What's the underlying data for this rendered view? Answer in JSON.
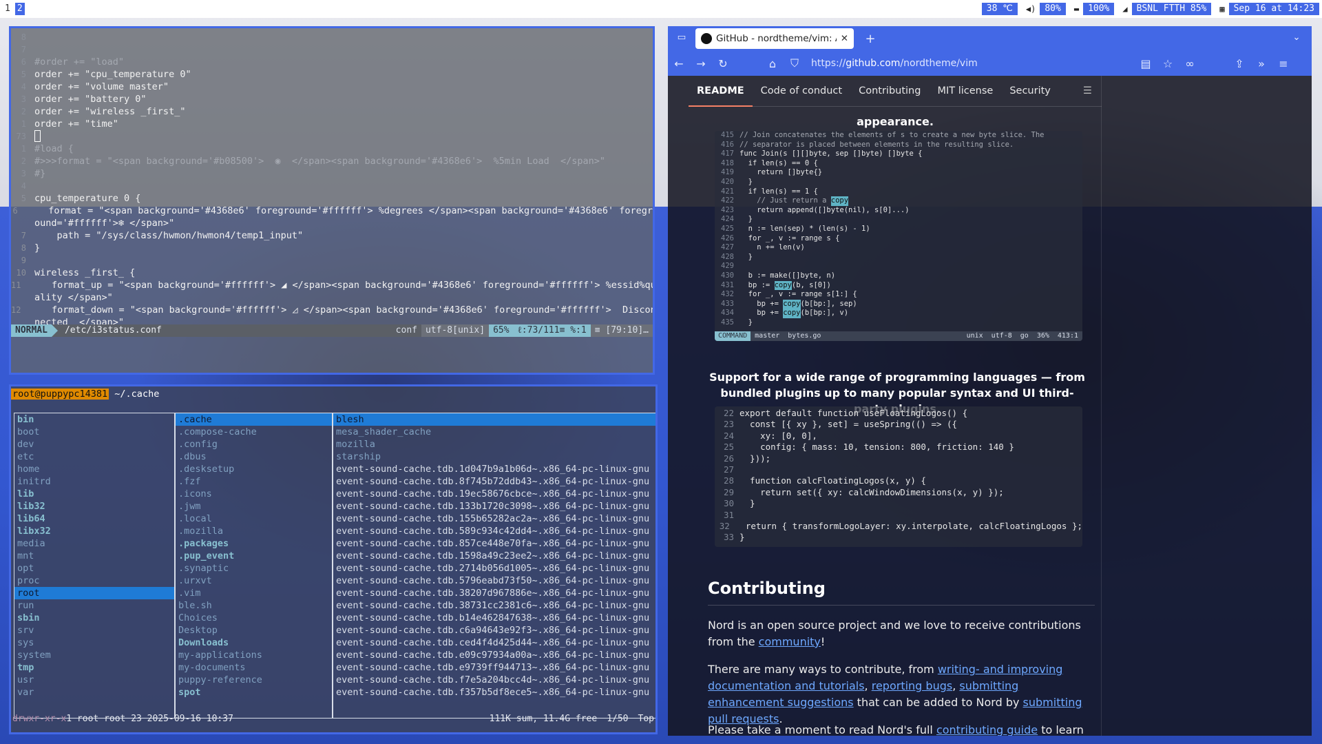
{
  "bar": {
    "workspaces": [
      "1",
      "2"
    ],
    "temperature": "38 ℃",
    "volume": "80%",
    "battery": "100%",
    "wireless": "BSNL FTTH 85%",
    "time": "Sep 16 at 14:23"
  },
  "vim": {
    "lines": [
      {
        "n": "8",
        "t": ""
      },
      {
        "n": "7",
        "t": ""
      },
      {
        "n": "6",
        "t": "#order += \"load\"",
        "c": "cmt"
      },
      {
        "n": "5",
        "t": "order += \"cpu_temperature 0\""
      },
      {
        "n": "4",
        "t": "order += \"volume master\""
      },
      {
        "n": "3",
        "t": "order += \"battery 0\""
      },
      {
        "n": "2",
        "t": "order += \"wireless _first_\""
      },
      {
        "n": "1",
        "t": "order += \"time\""
      },
      {
        "n": "73",
        "t": "",
        "cursor": true
      },
      {
        "n": "1",
        "t": "#load {",
        "c": "cmt"
      },
      {
        "n": "2",
        "t": "#>>>format = \"<span background='#b08500'>  ◉  </span><span background='#4368e6'>  %5min Load  </span>\"",
        "c": "cmt"
      },
      {
        "n": "3",
        "t": "#}",
        "c": "cmt"
      },
      {
        "n": "4",
        "t": ""
      },
      {
        "n": "5",
        "t": "cpu_temperature 0 {"
      },
      {
        "n": "6",
        "t": "    format = \"<span background='#4368e6' foreground='#ffffff'> %degrees </span><span background='#4368e6' foregr"
      },
      {
        "n": "",
        "t": "ound='#ffffff'>❄ </span>\""
      },
      {
        "n": "7",
        "t": "    path = \"/sys/class/hwmon/hwmon4/temp1_input\""
      },
      {
        "n": "8",
        "t": "}"
      },
      {
        "n": "9",
        "t": ""
      },
      {
        "n": "10",
        "t": "wireless _first_ {"
      },
      {
        "n": "11",
        "t": "    format_up = \"<span background='#ffffff'> ◢ </span><span background='#4368e6' foreground='#ffffff'> %essid%qu"
      },
      {
        "n": "",
        "t": "ality </span>\""
      },
      {
        "n": "12",
        "t": "    format_down = \"<span background='#ffffff'> ◿ </span><span background='#4368e6' foreground='#ffffff'>  Discon"
      },
      {
        "n": "",
        "t": "nected  </span>\""
      }
    ],
    "status": {
      "mode": "NORMAL",
      "file": "/etc/i3status.conf",
      "filetype": "conf",
      "encoding": "utf-8[unix]",
      "percent": "65%",
      "position": "ℓ:73/111≡ %:1",
      "extra": "≡ [79:10]…"
    }
  },
  "ranger": {
    "user": "root@puppypc14381",
    "path": " ~/.cache",
    "col1": [
      {
        "t": "bin",
        "k": "dir"
      },
      {
        "t": "boot",
        "k": "hid"
      },
      {
        "t": "dev",
        "k": "hid"
      },
      {
        "t": "etc",
        "k": "hid"
      },
      {
        "t": "home",
        "k": "hid"
      },
      {
        "t": "initrd",
        "k": "hid"
      },
      {
        "t": "lib",
        "k": "dir"
      },
      {
        "t": "lib32",
        "k": "dir"
      },
      {
        "t": "lib64",
        "k": "dir"
      },
      {
        "t": "libx32",
        "k": "dir"
      },
      {
        "t": "media",
        "k": "hid"
      },
      {
        "t": "mnt",
        "k": "hid"
      },
      {
        "t": "opt",
        "k": "hid"
      },
      {
        "t": "proc",
        "k": "hid"
      },
      {
        "t": "root",
        "k": "sel"
      },
      {
        "t": "run",
        "k": "hid"
      },
      {
        "t": "sbin",
        "k": "dir"
      },
      {
        "t": "srv",
        "k": "hid"
      },
      {
        "t": "sys",
        "k": "hid"
      },
      {
        "t": "system",
        "k": "hid"
      },
      {
        "t": "tmp",
        "k": "dir"
      },
      {
        "t": "usr",
        "k": "hid"
      },
      {
        "t": "var",
        "k": "hid"
      }
    ],
    "col2": [
      {
        "t": ".cache",
        "k": "sel"
      },
      {
        "t": ".compose-cache",
        "k": "hid"
      },
      {
        "t": ".config",
        "k": "hid"
      },
      {
        "t": ".dbus",
        "k": "hid"
      },
      {
        "t": ".desksetup",
        "k": "hid"
      },
      {
        "t": ".fzf",
        "k": "hid"
      },
      {
        "t": ".icons",
        "k": "hid"
      },
      {
        "t": ".jwm",
        "k": "hid"
      },
      {
        "t": ".local",
        "k": "hid"
      },
      {
        "t": ".mozilla",
        "k": "hid"
      },
      {
        "t": ".packages",
        "k": "dir"
      },
      {
        "t": ".pup_event",
        "k": "dir"
      },
      {
        "t": ".synaptic",
        "k": "hid"
      },
      {
        "t": ".urxvt",
        "k": "hid"
      },
      {
        "t": ".vim",
        "k": "hid"
      },
      {
        "t": "ble.sh",
        "k": "hid"
      },
      {
        "t": "Choices",
        "k": "hid"
      },
      {
        "t": "Desktop",
        "k": "hid"
      },
      {
        "t": "Downloads",
        "k": "dir"
      },
      {
        "t": "my-applications",
        "k": "hid"
      },
      {
        "t": "my-documents",
        "k": "hid"
      },
      {
        "t": "puppy-reference",
        "k": "hid"
      },
      {
        "t": "spot",
        "k": "dir"
      }
    ],
    "col3": [
      {
        "t": "blesh",
        "k": "sel"
      },
      {
        "t": "mesa_shader_cache",
        "k": "hid"
      },
      {
        "t": "mozilla",
        "k": "hid"
      },
      {
        "t": "starship",
        "k": "hid"
      },
      {
        "t": "event-sound-cache.tdb.1d047b9a1b06d~.x86_64-pc-linux-gnu",
        "k": "file"
      },
      {
        "t": "event-sound-cache.tdb.8f745b72ddb43~.x86_64-pc-linux-gnu",
        "k": "file"
      },
      {
        "t": "event-sound-cache.tdb.19ec58676cbce~.x86_64-pc-linux-gnu",
        "k": "file"
      },
      {
        "t": "event-sound-cache.tdb.133b1720c3098~.x86_64-pc-linux-gnu",
        "k": "file"
      },
      {
        "t": "event-sound-cache.tdb.155b65282ac2a~.x86_64-pc-linux-gnu",
        "k": "file"
      },
      {
        "t": "event-sound-cache.tdb.589c934c42dd4~.x86_64-pc-linux-gnu",
        "k": "file"
      },
      {
        "t": "event-sound-cache.tdb.857ce448e70fa~.x86_64-pc-linux-gnu",
        "k": "file"
      },
      {
        "t": "event-sound-cache.tdb.1598a49c23ee2~.x86_64-pc-linux-gnu",
        "k": "file"
      },
      {
        "t": "event-sound-cache.tdb.2714b056d1005~.x86_64-pc-linux-gnu",
        "k": "file"
      },
      {
        "t": "event-sound-cache.tdb.5796eabd73f50~.x86_64-pc-linux-gnu",
        "k": "file"
      },
      {
        "t": "event-sound-cache.tdb.38207d967886e~.x86_64-pc-linux-gnu",
        "k": "file"
      },
      {
        "t": "event-sound-cache.tdb.38731cc2381c6~.x86_64-pc-linux-gnu",
        "k": "file"
      },
      {
        "t": "event-sound-cache.tdb.b14e462847638~.x86_64-pc-linux-gnu",
        "k": "file"
      },
      {
        "t": "event-sound-cache.tdb.c6a94643e92f3~.x86_64-pc-linux-gnu",
        "k": "file"
      },
      {
        "t": "event-sound-cache.tdb.ced4f4d425d44~.x86_64-pc-linux-gnu",
        "k": "file"
      },
      {
        "t": "event-sound-cache.tdb.e09c97934a00a~.x86_64-pc-linux-gnu",
        "k": "file"
      },
      {
        "t": "event-sound-cache.tdb.e9739ff944713~.x86_64-pc-linux-gnu",
        "k": "file"
      },
      {
        "t": "event-sound-cache.tdb.f7e5a204bcc4d~.x86_64-pc-linux-gnu",
        "k": "file"
      },
      {
        "t": "event-sound-cache.tdb.f357b5df8ece5~.x86_64-pc-linux-gnu",
        "k": "file"
      }
    ],
    "footer": {
      "perm": "drwxr-xr-x",
      "info": " 1 root root 23 2025-09-16 10:37",
      "sum": "111K sum, 11.4G free",
      "pos": "1/50",
      "scroll": "Top"
    }
  },
  "browser": {
    "tab_title": "GitHub - nordtheme/vim: A",
    "url_prefix": "https://",
    "url_host": "github.com",
    "url_path": "/nordtheme/vim",
    "readme_tabs": [
      "README",
      "Code of conduct",
      "Contributing",
      "MIT license",
      "Security"
    ],
    "appearance_heading": "appearance.",
    "code1": [
      {
        "n": "415",
        "t": "// Join concatenates the elements of s to create a new byte slice. The",
        "c": "cmt"
      },
      {
        "n": "416",
        "t": "// separator is placed between elements in the resulting slice.",
        "c": "cmt"
      },
      {
        "n": "417",
        "t": "func Join(s [][]byte, sep []byte) []byte {"
      },
      {
        "n": "418",
        "t": "  if len(s) == 0 {"
      },
      {
        "n": "419",
        "t": "    return []byte{}"
      },
      {
        "n": "420",
        "t": "  }"
      },
      {
        "n": "421",
        "t": "  if len(s) == 1 {"
      },
      {
        "n": "422",
        "t": "    // Just return a ",
        "c": "cmt",
        "hl": "copy"
      },
      {
        "n": "423",
        "t": "    return append([]byte(nil), s[0]...)"
      },
      {
        "n": "424",
        "t": "  }"
      },
      {
        "n": "425",
        "t": "  n := len(sep) * (len(s) - 1)"
      },
      {
        "n": "426",
        "t": "  for _, v := range s {"
      },
      {
        "n": "427",
        "t": "    n += len(v)"
      },
      {
        "n": "428",
        "t": "  }"
      },
      {
        "n": "429",
        "t": ""
      },
      {
        "n": "430",
        "t": "  b := make([]byte, n)"
      },
      {
        "n": "431",
        "t": "  bp := ",
        "hl": "copy",
        "after": "(b, s[0])"
      },
      {
        "n": "432",
        "t": "  for _, v := range s[1:] {"
      },
      {
        "n": "433",
        "t": "    bp += ",
        "hl": "copy",
        "after": "(b[bp:], sep)"
      },
      {
        "n": "434",
        "t": "    bp += ",
        "hl": "copy",
        "after": "(b[bp:], v)"
      },
      {
        "n": "435",
        "t": "  }"
      }
    ],
    "code1_status": {
      "mode": "COMMAND",
      "branch": " master",
      "file": "bytes.go",
      "fmt": "unix",
      "enc": "utf-8",
      "ft": "go",
      "pct": "36%",
      "pos": "413:1"
    },
    "support_heading": "Support for a wide range of programming languages — from bundled plugins up to many popular syntax and UI third-party plugins.",
    "code2": [
      {
        "n": "22",
        "t": "export default function useFloatingLogos() {"
      },
      {
        "n": "23",
        "t": "  const [{ xy }, set] = useSpring(() => ({"
      },
      {
        "n": "24",
        "t": "    xy: [0, 0],"
      },
      {
        "n": "25",
        "t": "    config: { mass: 10, tension: 800, friction: 140 }"
      },
      {
        "n": "26",
        "t": "  }));"
      },
      {
        "n": "27",
        "t": ""
      },
      {
        "n": "28",
        "t": "  function calcFloatingLogos(x, y) {"
      },
      {
        "n": "29",
        "t": "    return set({ xy: calcWindowDimensions(x, y) });"
      },
      {
        "n": "30",
        "t": "  }"
      },
      {
        "n": "31",
        "t": ""
      },
      {
        "n": "32",
        "t": "  return { transformLogoLayer: xy.interpolate, calcFloatingLogos };"
      },
      {
        "n": "33",
        "t": "}"
      }
    ],
    "contributing_heading": "Contributing",
    "p1_a": "Nord is an open source project and we love to receive contributions from the ",
    "p1_link": "community",
    "p1_b": "!",
    "p2_a": "There are many ways to contribute, from ",
    "p2_l1": "writing- and improving documentation and tutorials",
    "p2_c1": ", ",
    "p2_l2": "reporting bugs",
    "p2_c2": ", ",
    "p2_l3": "submitting enhancement suggestions",
    "p2_b": " that can be added to Nord by ",
    "p2_l4": "submitting pull requests",
    "p2_end": ".",
    "p3_a": "Please take a moment to read Nord's full ",
    "p3_link": "contributing guide",
    "p3_b": " to learn"
  }
}
